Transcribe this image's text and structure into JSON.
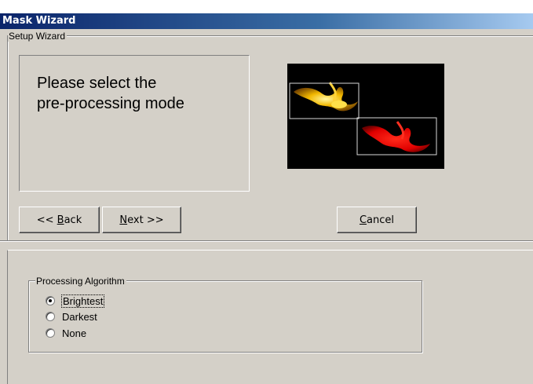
{
  "window": {
    "title": "Mask Wizard"
  },
  "setup": {
    "group_label": "Setup Wizard",
    "prompt": "Please select the\npre-processing mode"
  },
  "buttons": {
    "back": {
      "prefix": "<< ",
      "mnemonic": "B",
      "rest": "ack"
    },
    "next": {
      "mnemonic": "N",
      "rest": "ext >>"
    },
    "cancel": {
      "mnemonic": "C",
      "rest": "ancel"
    }
  },
  "algorithm": {
    "group_label": "Processing Algorithm",
    "options": [
      {
        "label": "Brightest",
        "checked": true
      },
      {
        "label": "Darkest",
        "checked": false
      },
      {
        "label": "None",
        "checked": false
      }
    ]
  }
}
